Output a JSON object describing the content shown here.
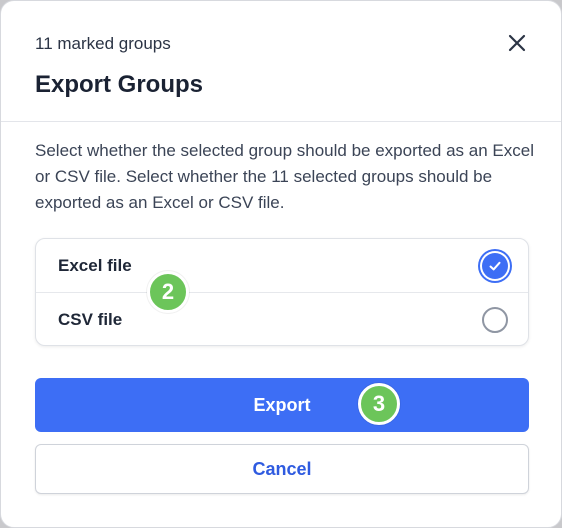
{
  "dialog": {
    "subtitle": "11 marked groups",
    "title": "Export Groups",
    "description": "Select whether the selected group should be exported as an Excel or CSV file. Select whether the 11 selected groups should be exported as an Excel or CSV file.",
    "close_icon": "close-icon"
  },
  "options": [
    {
      "label": "Excel file",
      "selected": true
    },
    {
      "label": "CSV file",
      "selected": false
    }
  ],
  "badges": {
    "step2": "2",
    "step3": "3"
  },
  "buttons": {
    "export_label": "Export",
    "cancel_label": "Cancel"
  },
  "colors": {
    "primary": "#3d6ef5",
    "badge": "#6cc55a",
    "title": "#1a2233"
  }
}
